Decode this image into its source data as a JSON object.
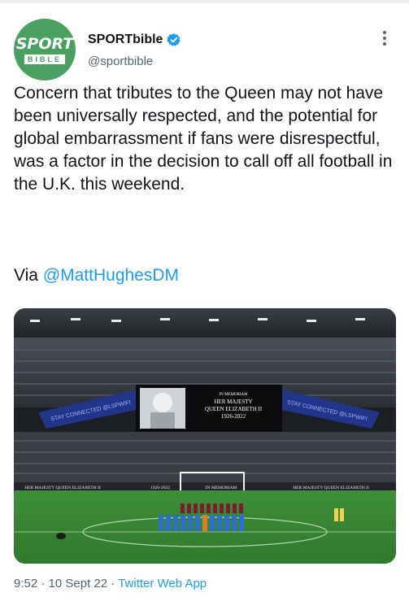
{
  "account": {
    "avatar_text_top": "SPORT",
    "avatar_text_bottom": "BIBLE",
    "display_name": "SPORTbible",
    "handle": "@sportbible"
  },
  "tweet": {
    "text": "Concern that tributes to the Queen may not have been universally respected, and the potential for global embarrassment if fans were disrespectful, was a factor in the decision to call off all football in the U.K. this weekend.",
    "via_prefix": "Via ",
    "mention": "@MattHughesDM"
  },
  "photo": {
    "screen_line1": "IN MEMORIAM",
    "screen_line2": "HER MAJESTY",
    "screen_line3": "QUEEN ELIZABETH II",
    "screen_line4": "1926-2022",
    "banner_left": "STAY CONNECTED @LSPWIFI",
    "banner_right": "STAY CONNECTED @LSPWIFI",
    "board_1": "HER MAJESTY QUEEN ELIZABETH II",
    "board_2": "1926-2022",
    "board_3": "IN MEMORIAM",
    "board_4": "HER MAJESTY QUEEN ELIZABETH II"
  },
  "footer": {
    "time": "9:52",
    "date": "10 Sept 22",
    "app": "Twitter Web App"
  },
  "colors": {
    "accent": "#1d9bf0",
    "verified": "#1d9bf0",
    "avatar_bg": "#4aa061",
    "secondary_text": "#536471"
  }
}
